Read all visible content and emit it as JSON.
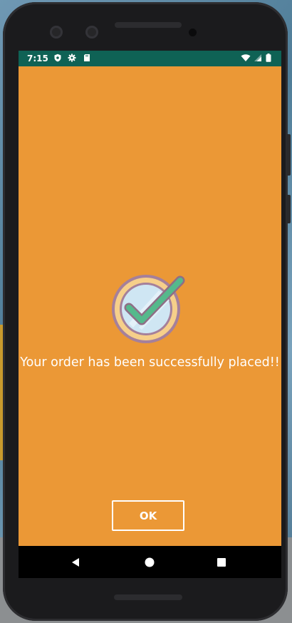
{
  "statusbar": {
    "time": "7:15",
    "left_icons": [
      "shield-icon",
      "gear-icon",
      "sd-card-icon"
    ],
    "right_icons": [
      "wifi-icon",
      "signal-icon",
      "battery-icon"
    ],
    "background": "#0f6255"
  },
  "screen": {
    "background": "#eb9836",
    "icon": "check-circle-icon",
    "message": "Your order has been successfully placed!!",
    "ok_label": "OK"
  },
  "navbar": {
    "buttons": [
      "back-icon",
      "home-icon",
      "recents-icon"
    ]
  }
}
